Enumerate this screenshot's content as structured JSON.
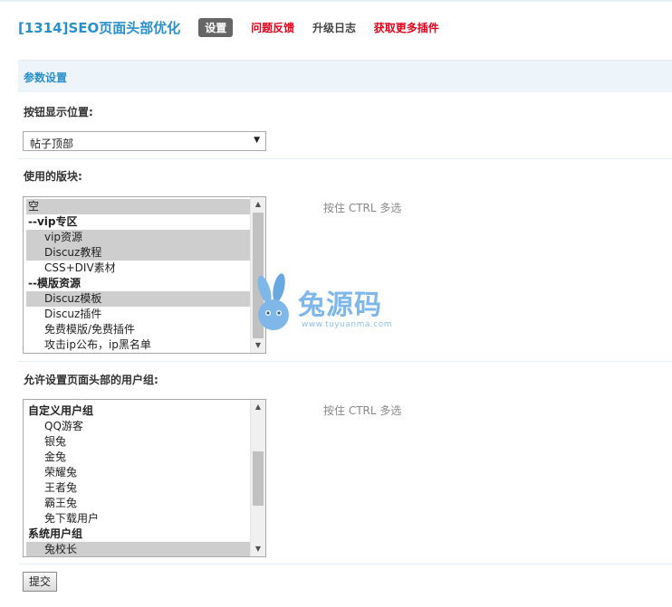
{
  "header": {
    "title": "[1314]SEO页面头部优化",
    "nav": [
      {
        "label": "设置"
      },
      {
        "label": "问题反馈"
      },
      {
        "label": "升级日志"
      },
      {
        "label": "获取更多插件"
      }
    ]
  },
  "section": {
    "title": "参数设置"
  },
  "button_position": {
    "label": "按钮显示位置:",
    "selected": "帖子顶部"
  },
  "forums": {
    "label": "使用的版块:",
    "hint": "按住 CTRL 多选",
    "options": [
      {
        "text": "空",
        "selected": true
      },
      {
        "text": "--vip专区",
        "group": true
      },
      {
        "text": "vip资源",
        "selected": true
      },
      {
        "text": "Discuz教程",
        "selected": true
      },
      {
        "text": "CSS+DIV素材"
      },
      {
        "text": "--模版资源",
        "group": true
      },
      {
        "text": "Discuz模板",
        "selected": true
      },
      {
        "text": "Discuz插件"
      },
      {
        "text": "免费模版/免费插件"
      },
      {
        "text": "攻击ip公布，ip黑名单"
      }
    ]
  },
  "usergroups": {
    "label": "允许设置页面头部的用户组:",
    "hint": "按住 CTRL 多选",
    "options": [
      {
        "text": "自定义用户组",
        "group": true
      },
      {
        "text": "QQ游客"
      },
      {
        "text": "银兔"
      },
      {
        "text": "金兔"
      },
      {
        "text": "荣耀兔"
      },
      {
        "text": "王者兔"
      },
      {
        "text": "霸王兔"
      },
      {
        "text": "免下载用户"
      },
      {
        "text": "系统用户组",
        "group": true
      },
      {
        "text": "兔校长",
        "selected": true
      }
    ]
  },
  "watermark": {
    "text": "兔源码",
    "url": "www.tuyuanma.com"
  },
  "submit": {
    "label": "提交"
  }
}
